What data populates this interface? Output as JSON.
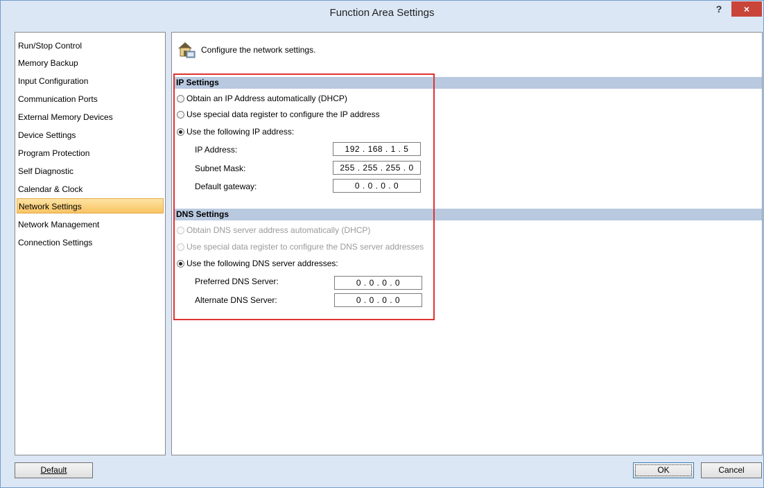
{
  "window": {
    "title": "Function Area Settings",
    "help_label": "?",
    "close_label": "×"
  },
  "sidebar": {
    "items": [
      {
        "label": "Run/Stop Control"
      },
      {
        "label": "Memory Backup"
      },
      {
        "label": "Input Configuration"
      },
      {
        "label": "Communication Ports"
      },
      {
        "label": "External Memory Devices"
      },
      {
        "label": "Device Settings"
      },
      {
        "label": "Program Protection"
      },
      {
        "label": "Self Diagnostic"
      },
      {
        "label": "Calendar & Clock"
      },
      {
        "label": "Network Settings",
        "selected": true
      },
      {
        "label": "Network Management"
      },
      {
        "label": "Connection Settings"
      }
    ]
  },
  "main": {
    "header_text": "Configure the network settings.",
    "header_icon": "network-house-icon",
    "ip_settings": {
      "title": "IP Settings",
      "options": [
        {
          "label": "Obtain an IP Address automatically (DHCP)",
          "checked": false
        },
        {
          "label": "Use special data register to configure the IP address",
          "checked": false
        },
        {
          "label": "Use the following IP address:",
          "checked": true
        }
      ],
      "fields": [
        {
          "label": "IP Address:",
          "value": "192 . 168 .  1  .  5"
        },
        {
          "label": "Subnet Mask:",
          "value": "255 . 255 . 255 .  0"
        },
        {
          "label": "Default gateway:",
          "value": "0  .  0  .  0  .  0"
        }
      ]
    },
    "dns_settings": {
      "title": "DNS Settings",
      "options": [
        {
          "label": "Obtain DNS server address automatically (DHCP)",
          "checked": false,
          "disabled": true
        },
        {
          "label": "Use special data register to configure the DNS server addresses",
          "checked": false,
          "disabled": true
        },
        {
          "label": "Use the following DNS server addresses:",
          "checked": true,
          "disabled": false
        }
      ],
      "fields": [
        {
          "label": "Preferred DNS Server:",
          "value": "0  .  0  .  0  .  0"
        },
        {
          "label": "Alternate DNS Server:",
          "value": "0  .  0  .  0  .  0"
        }
      ]
    }
  },
  "footer": {
    "default_label": "Default",
    "ok_label": "OK",
    "cancel_label": "Cancel"
  },
  "colors": {
    "accent_highlight": "#e03131",
    "section_band": "#b8c9e0",
    "selected_item": "#f9c463"
  }
}
